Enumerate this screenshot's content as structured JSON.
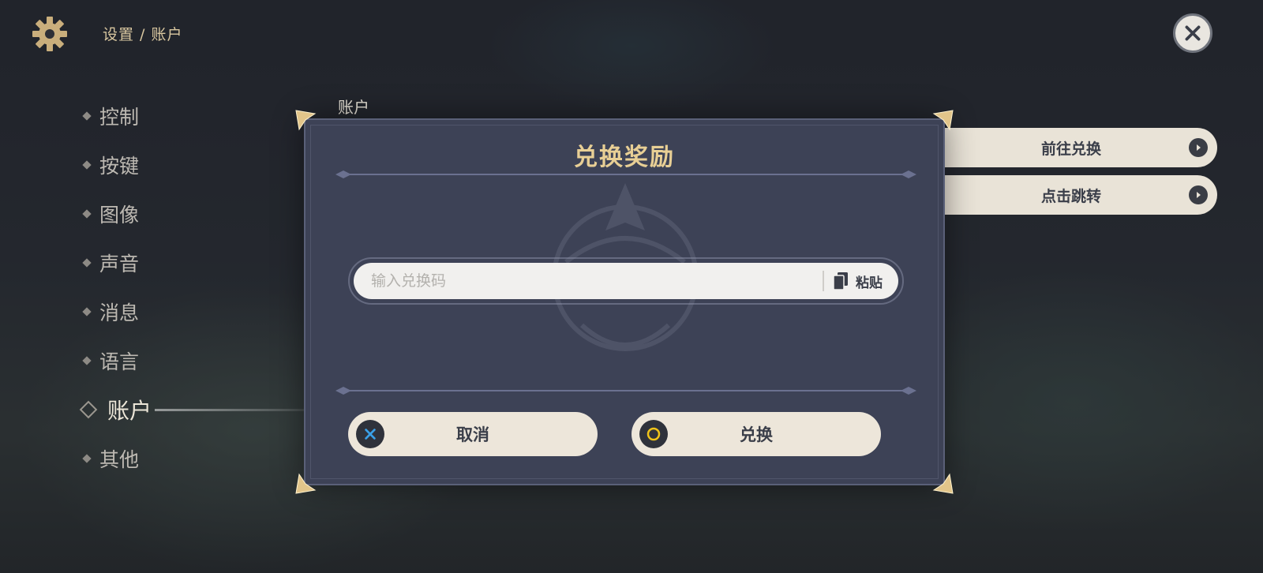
{
  "header": {
    "breadcrumb": "设置 / 账户",
    "gear_icon": "gear-icon",
    "close_icon": "close-icon"
  },
  "sidebar": {
    "items": [
      {
        "label": "控制"
      },
      {
        "label": "按键"
      },
      {
        "label": "图像"
      },
      {
        "label": "声音"
      },
      {
        "label": "消息"
      },
      {
        "label": "语言"
      },
      {
        "label": "账户",
        "active": true
      },
      {
        "label": "其他"
      }
    ]
  },
  "main": {
    "section_label": "账户",
    "buttons": [
      {
        "label": "前往兑换"
      },
      {
        "label": "点击跳转"
      }
    ]
  },
  "dialog": {
    "title": "兑换奖励",
    "input": {
      "value": "",
      "placeholder": "输入兑换码"
    },
    "paste_label": "粘贴",
    "cancel_label": "取消",
    "confirm_label": "兑换"
  },
  "colors": {
    "accent_gold": "#e8cf95",
    "dialog_bg": "#3d4256",
    "button_bg": "#ede6da",
    "cancel_icon": "#3aa0e8",
    "confirm_icon": "#f0c419"
  }
}
